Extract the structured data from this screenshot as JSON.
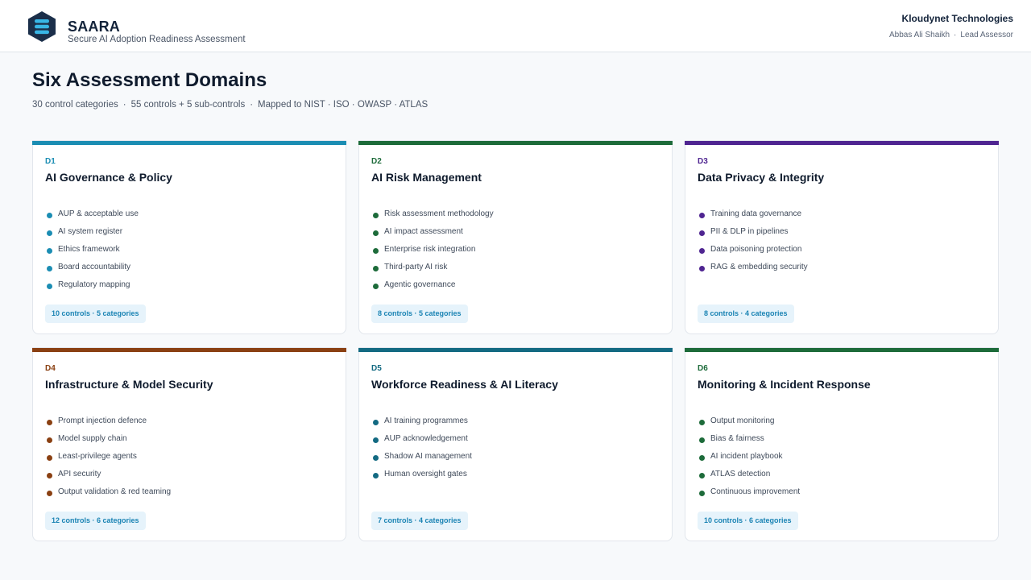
{
  "header": {
    "brand_title": "SAARA",
    "brand_subtitle": "Secure AI Adoption Readiness Assessment",
    "org_name": "Kloudynet Technologies",
    "assessor_name": "Abbas Ali Shaikh",
    "assessor_separator": "·",
    "assessor_role": "Lead Assessor",
    "logo_icon": "hexagon-stack-logo-icon",
    "logo_colors": {
      "hex": "#1b2f4a",
      "bars": "#38b6e6"
    }
  },
  "page": {
    "title": "Six Assessment Domains",
    "meta": [
      "30 control categories",
      "55 controls + 5 sub-controls",
      "Mapped to NIST · ISO · OWASP · ATLAS"
    ],
    "meta_separator": "·"
  },
  "domains": [
    {
      "code": "D1",
      "title": "AI Governance & Policy",
      "color": "#1b8db3",
      "items": [
        "AUP & acceptable use",
        "AI system register",
        "Ethics framework",
        "Board accountability",
        "Regulatory mapping"
      ],
      "badge": "10 controls · 5 categories"
    },
    {
      "code": "D2",
      "title": "AI Risk Management",
      "color": "#1d6b3a",
      "items": [
        "Risk assessment methodology",
        "AI impact assessment",
        "Enterprise risk integration",
        "Third-party AI risk",
        "Agentic governance"
      ],
      "badge": "8 controls · 5 categories"
    },
    {
      "code": "D3",
      "title": "Data Privacy & Integrity",
      "color": "#4f2591",
      "items": [
        "Training data governance",
        "PII & DLP in pipelines",
        "Data poisoning protection",
        "RAG & embedding security"
      ],
      "badge": "8 controls · 4 categories"
    },
    {
      "code": "D4",
      "title": "Infrastructure & Model Security",
      "color": "#8a4012",
      "items": [
        "Prompt injection defence",
        "Model supply chain",
        "Least-privilege agents",
        "API security",
        "Output validation & red teaming"
      ],
      "badge": "12 controls · 6 categories"
    },
    {
      "code": "D5",
      "title": "Workforce Readiness & AI Literacy",
      "color": "#136a82",
      "items": [
        "AI training programmes",
        "AUP acknowledgement",
        "Shadow AI management",
        "Human oversight gates"
      ],
      "badge": "7 controls · 4 categories"
    },
    {
      "code": "D6",
      "title": "Monitoring & Incident Response",
      "color": "#1d6b3a",
      "items": [
        "Output monitoring",
        "Bias & fairness",
        "AI incident playbook",
        "ATLAS detection",
        "Continuous improvement"
      ],
      "badge": "10 controls · 6 categories"
    }
  ],
  "colors": {
    "background": "#f7f9fb",
    "badge_bg": "#e6f3fb",
    "badge_text": "#1b84b4"
  }
}
